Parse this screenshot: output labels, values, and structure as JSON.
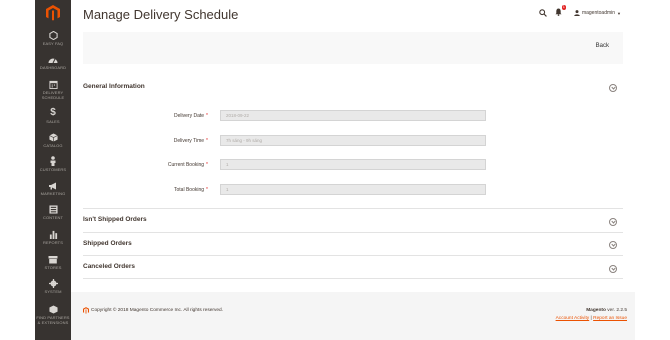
{
  "sidebar": {
    "items": [
      {
        "label": "EASY FAQ",
        "icon": "hexagon-icon"
      },
      {
        "label": "DASHBOARD",
        "icon": "dashboard-gauge-icon"
      },
      {
        "label": "DELIVERY SCHEDULE",
        "icon": "calendar-icon"
      },
      {
        "label": "SALES",
        "icon": "dollar-icon"
      },
      {
        "label": "CATALOG",
        "icon": "cube-icon"
      },
      {
        "label": "CUSTOMERS",
        "icon": "person-icon"
      },
      {
        "label": "MARKETING",
        "icon": "megaphone-icon"
      },
      {
        "label": "CONTENT",
        "icon": "content-grid-icon"
      },
      {
        "label": "REPORTS",
        "icon": "bar-chart-icon"
      },
      {
        "label": "STORES",
        "icon": "store-icon"
      },
      {
        "label": "SYSTEM",
        "icon": "gear-icon"
      },
      {
        "label": "FIND PARTNERS & EXTENSIONS",
        "icon": "box-icon"
      }
    ]
  },
  "header": {
    "title": "Manage Delivery Schedule",
    "notifications_count": "1",
    "user": "magentoadmin"
  },
  "actions": {
    "back_label": "Back"
  },
  "general": {
    "title": "General Information",
    "fields": [
      {
        "label": "Delivery Date",
        "value": "2018-09-22"
      },
      {
        "label": "Delivery Time",
        "value": "7h sáng - 9h sáng"
      },
      {
        "label": "Current Booking",
        "value": "1"
      },
      {
        "label": "Total Booking",
        "value": "1"
      }
    ]
  },
  "sections": [
    {
      "title": "Isn't Shipped Orders"
    },
    {
      "title": "Shipped Orders"
    },
    {
      "title": "Canceled Orders"
    }
  ],
  "footer": {
    "copyright": "Copyright © 2018 Magento Commerce Inc. All rights reserved.",
    "brand": "Magento",
    "version": " ver. 2.2.5",
    "account_activity": "Account Activity",
    "divider": "|",
    "report_issue": "Report an Issue"
  },
  "colors": {
    "sidebar_bg": "#373330",
    "accent": "#eb5202",
    "required": "#e22626"
  }
}
